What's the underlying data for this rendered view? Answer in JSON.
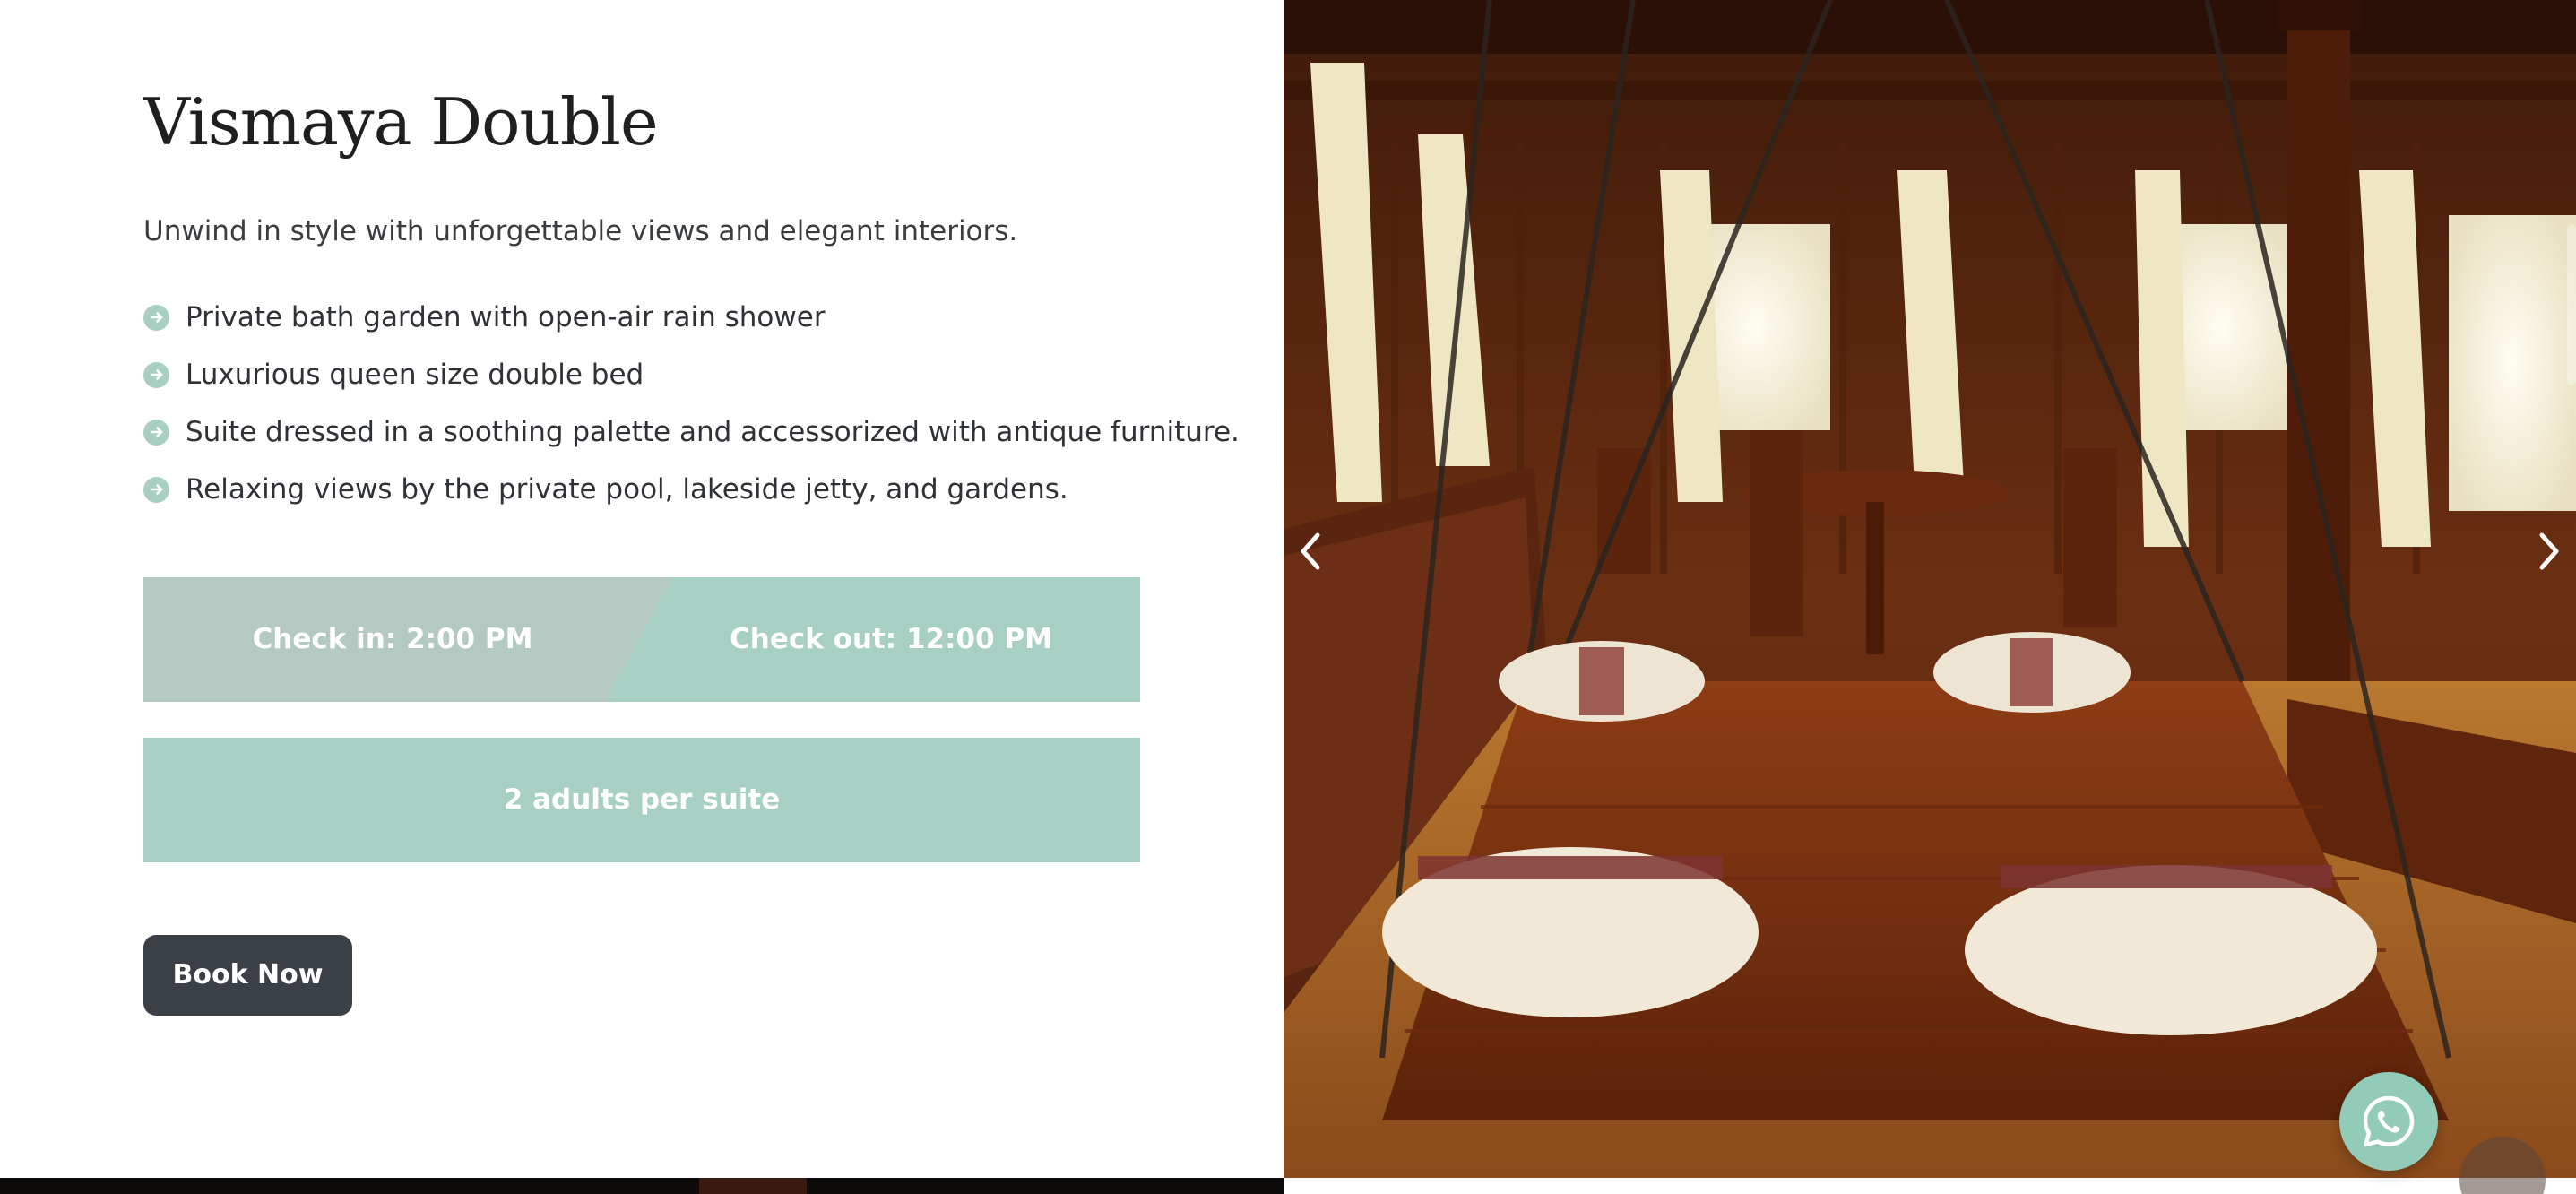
{
  "room": {
    "title": "Vismaya Double",
    "intro": "Unwind in style with unforgettable views and elegant interiors.",
    "features": [
      "Private bath garden with open-air rain shower",
      "Luxurious queen size double bed",
      "Suite dressed in a soothing palette and accessorized with antique furniture.",
      "Relaxing views by the private pool, lakeside jetty, and gardens."
    ]
  },
  "info": {
    "check_in": "Check in: 2:00 PM",
    "check_out": "Check out: 12:00 PM",
    "capacity": "2 adults per suite"
  },
  "actions": {
    "book_label": "Book Now"
  },
  "gallery": {
    "prev_icon": "chevron-left-icon",
    "next_icon": "chevron-right-icon",
    "contact_icon": "whatsapp-icon"
  },
  "colors": {
    "accent_mint": "#a8cfc4",
    "accent_gray_mint": "#b5c9c3",
    "button_dark": "#3b4047",
    "title_text": "#1d1f21",
    "whatsapp_bubble": "#93cbb9"
  }
}
